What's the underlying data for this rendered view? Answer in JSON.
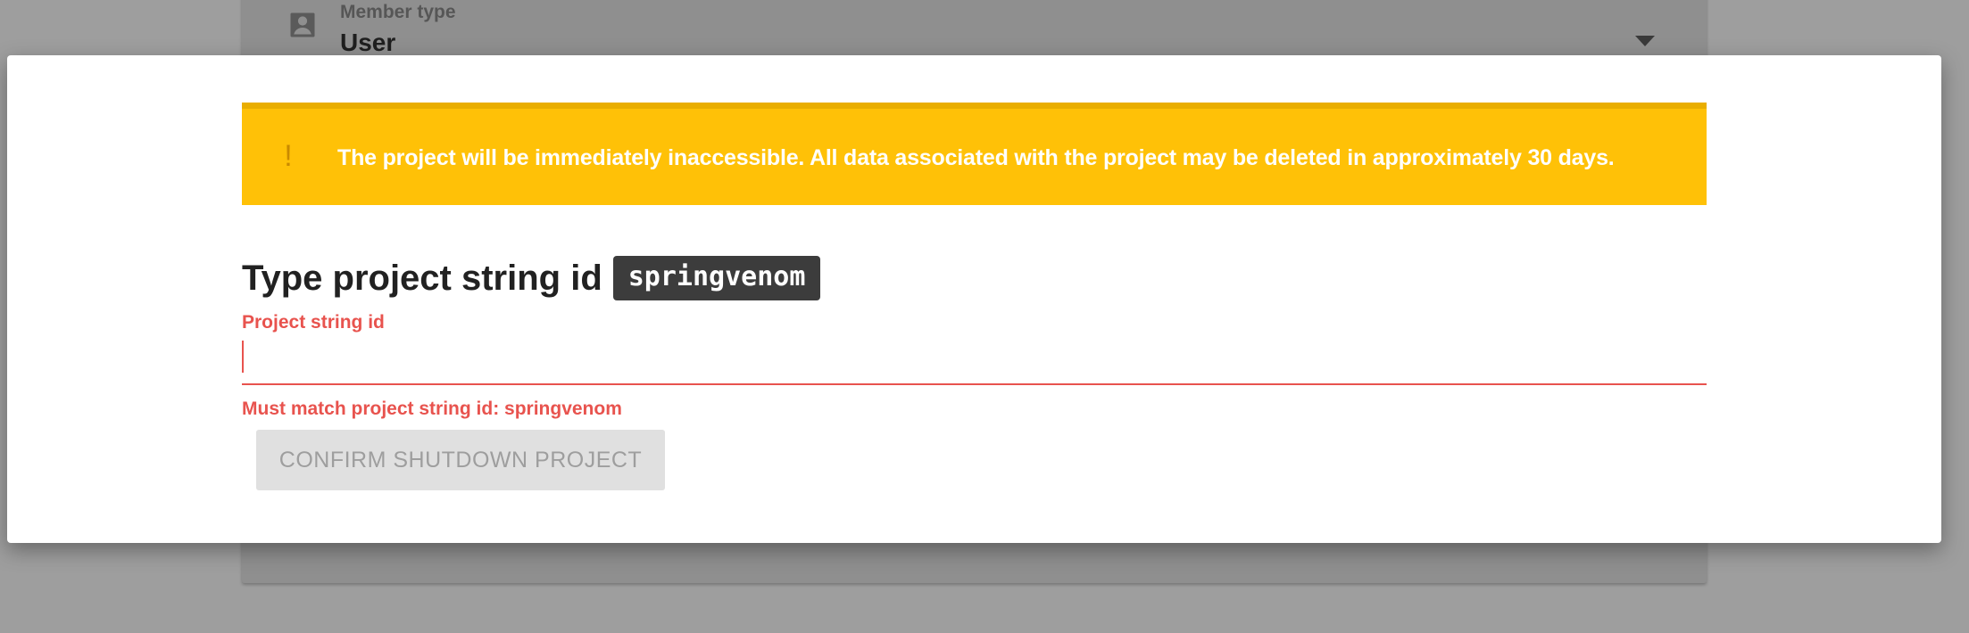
{
  "background": {
    "member_type_label": "Member type",
    "member_type_value": "User",
    "person_icon": "account-box-icon",
    "dropdown_icon": "arrow-drop-down-icon"
  },
  "dialog": {
    "warning": {
      "icon": "exclamation-icon",
      "icon_glyph": "!",
      "text": "The project will be immediately inaccessible. All data associated with the project may be deleted in approximately 30 days."
    },
    "heading_prefix": "Type project string id",
    "project_id_chip": "springvenom",
    "input": {
      "label": "Project string id",
      "value": "",
      "error": "Must match project string id: springvenom"
    },
    "confirm_button_label": "CONFIRM SHUTDOWN PROJECT"
  },
  "colors": {
    "warning_bg": "#ffc107",
    "error": "#e8534e",
    "chip_bg": "#3c3c3c",
    "disabled_button_bg": "#e0e0e0",
    "overlay": "#9e9e9e"
  }
}
